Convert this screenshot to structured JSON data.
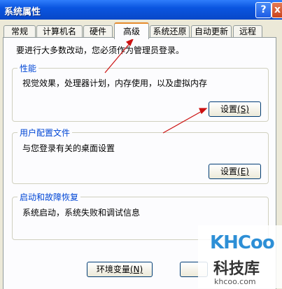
{
  "window": {
    "title": "系统属性",
    "help_label": "?",
    "close_label": "x"
  },
  "tabs": [
    {
      "label": "常规"
    },
    {
      "label": "计算机名"
    },
    {
      "label": "硬件"
    },
    {
      "label": "高级"
    },
    {
      "label": "系统还原"
    },
    {
      "label": "自动更新"
    },
    {
      "label": "远程"
    }
  ],
  "notice": "要进行大多数改动，您必须作为管理员登录。",
  "performance": {
    "title": "性能",
    "desc": "视觉效果，处理器计划，内存使用，以及虚拟内存",
    "button": "设置",
    "key": "(S)"
  },
  "profiles": {
    "title": "用户配置文件",
    "desc": "与您登录有关的桌面设置",
    "button": "设置",
    "key": "(E)"
  },
  "startup": {
    "title": "启动和故障恢复",
    "desc": "系统启动，系统失败和调试信息"
  },
  "bottom": {
    "env_button": "环境变量",
    "env_key": "(N)"
  },
  "watermark": {
    "logo": "KHCoo",
    "cn": "科技库",
    "url": "khcoo.com"
  },
  "colors": {
    "arrow": "#cc1111",
    "group_title": "#0046d5",
    "title_bar": "#0a55e0"
  }
}
